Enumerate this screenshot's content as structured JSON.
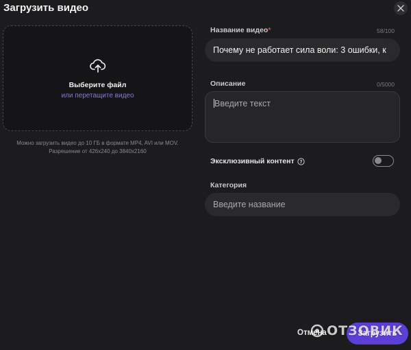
{
  "dialog": {
    "title": "Загрузить видео",
    "close_icon": "close-icon"
  },
  "upload": {
    "icon": "upload-icon",
    "primary_text": "Выберите файл",
    "secondary_text": "или перетащите видео",
    "hint_line1": "Можно загрузить видео до 10 ГБ в формате MP4, AVI или MOV.",
    "hint_line2": "Разрешение от 426x240 до 3840x2160"
  },
  "fields": {
    "title": {
      "label": "Название видео",
      "required_mark": "*",
      "counter": "58/100",
      "value": "Почему не работает сила воли: 3 ошибки, к"
    },
    "description": {
      "label": "Описание",
      "counter": "0/5000",
      "placeholder": "Введите текст"
    },
    "exclusive": {
      "label": "Эксклюзивный контент",
      "info_icon": "info-icon",
      "enabled": false
    },
    "category": {
      "label": "Категория",
      "placeholder": "Введите название"
    }
  },
  "actions": {
    "cancel_label": "Отмена",
    "submit_label": "Загрузить"
  },
  "watermark": {
    "text": "ОТЗОВИК"
  },
  "colors": {
    "accent": "#5b3fd6",
    "link": "#8c76e0",
    "required": "#e0405a",
    "background": "#1c1c1e"
  }
}
